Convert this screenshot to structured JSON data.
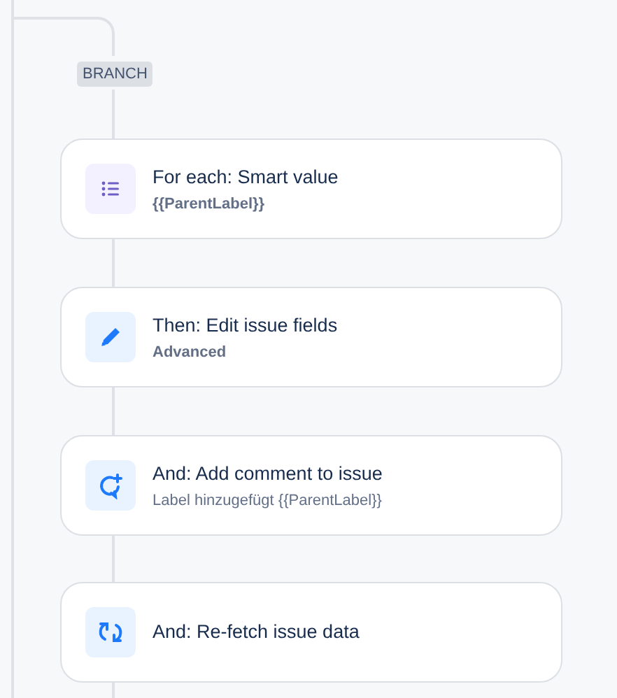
{
  "branch_label": "BRANCH",
  "steps": [
    {
      "kind": "for-each",
      "title": "For each: Smart value",
      "subtitle": "{{ParentLabel}}",
      "subtitle_bold": true
    },
    {
      "kind": "edit",
      "title": "Then: Edit issue fields",
      "subtitle": "Advanced",
      "subtitle_bold": true
    },
    {
      "kind": "comment",
      "title": "And: Add comment to issue",
      "subtitle": "Label hinzugefügt {{ParentLabel}}",
      "subtitle_bold": false
    },
    {
      "kind": "refetch",
      "title": "And: Re-fetch issue data"
    }
  ]
}
